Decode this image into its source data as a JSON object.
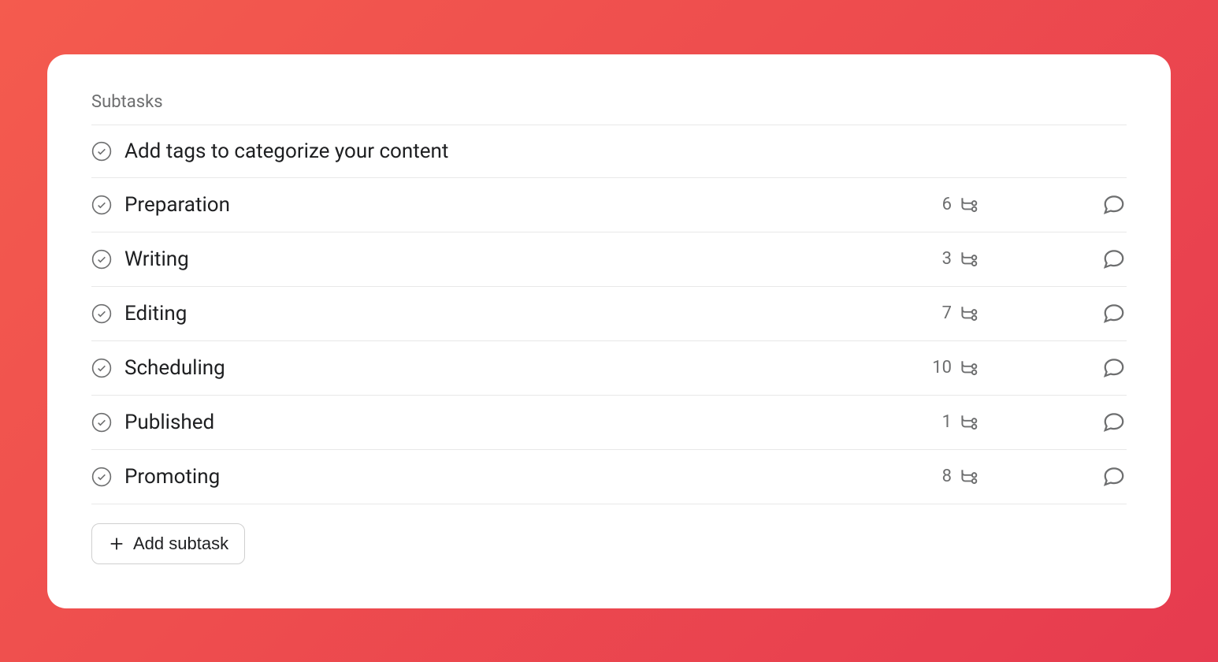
{
  "section": {
    "title": "Subtasks"
  },
  "subtasks": [
    {
      "title": "Add tags to categorize your content",
      "count": null
    },
    {
      "title": "Preparation",
      "count": 6
    },
    {
      "title": "Writing",
      "count": 3
    },
    {
      "title": "Editing",
      "count": 7
    },
    {
      "title": "Scheduling",
      "count": 10
    },
    {
      "title": "Published",
      "count": 1
    },
    {
      "title": "Promoting",
      "count": 8
    }
  ],
  "actions": {
    "add_subtask_label": "Add subtask"
  }
}
